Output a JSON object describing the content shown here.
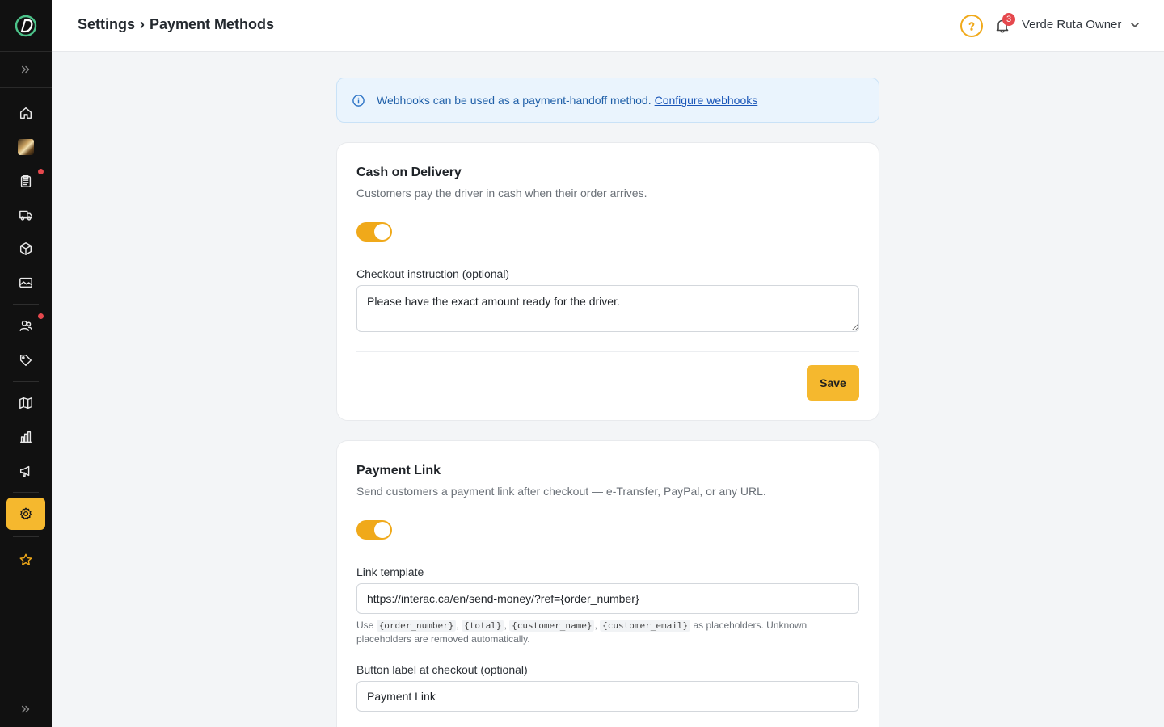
{
  "header": {
    "breadcrumb_parent": "Settings",
    "breadcrumb_separator": "›",
    "breadcrumb_current": "Payment Methods",
    "notification_count": "3",
    "user_name": "Verde Ruta Owner"
  },
  "sidebar": {
    "items": [
      {
        "name": "home",
        "icon": "home-icon",
        "has_dot": false
      },
      {
        "name": "store",
        "icon": "store-thumbnail",
        "has_dot": false
      },
      {
        "name": "orders",
        "icon": "clipboard-icon",
        "has_dot": true
      },
      {
        "name": "delivery",
        "icon": "truck-icon",
        "has_dot": false
      },
      {
        "name": "products",
        "icon": "box-icon",
        "has_dot": false
      },
      {
        "name": "media",
        "icon": "image-icon",
        "has_dot": false
      },
      {
        "name": "customers",
        "icon": "users-icon",
        "has_dot": true
      },
      {
        "name": "discounts",
        "icon": "tag-icon",
        "has_dot": false
      },
      {
        "name": "guides",
        "icon": "map-icon",
        "has_dot": false
      },
      {
        "name": "analytics",
        "icon": "bar-chart-icon",
        "has_dot": false
      },
      {
        "name": "marketing",
        "icon": "megaphone-icon",
        "has_dot": false
      },
      {
        "name": "settings",
        "icon": "gear-icon",
        "active": true
      },
      {
        "name": "favorites",
        "icon": "star-icon",
        "has_dot": false
      }
    ],
    "accent_color": "#f5b82e"
  },
  "banner": {
    "text": "Webhooks can be used as a payment-handoff method.",
    "link_label": "Configure webhooks"
  },
  "cash_on_delivery": {
    "title": "Cash on Delivery",
    "description": "Customers pay the driver in cash when their order arrives.",
    "enabled": true,
    "instruction_label": "Checkout instruction (optional)",
    "instruction_value": "Please have the exact amount ready for the driver.",
    "save_label": "Save"
  },
  "payment_link": {
    "title": "Payment Link",
    "description": "Send customers a payment link after checkout — e-Transfer, PayPal, or any URL.",
    "enabled": true,
    "template_label": "Link template",
    "template_value": "https://interac.ca/en/send-money/?ref={order_number}",
    "help_prefix": "Use",
    "placeholders": [
      "{order_number}",
      "{total}",
      "{customer_name}",
      "{customer_email}"
    ],
    "help_suffix": "as placeholders. Unknown placeholders are removed automatically.",
    "button_label_label": "Button label at checkout (optional)",
    "button_label_value": "Payment Link"
  },
  "colors": {
    "toggle_on": "#f0a91a",
    "info_blue": "#1f5fa8",
    "notification_red": "#e5484d"
  }
}
